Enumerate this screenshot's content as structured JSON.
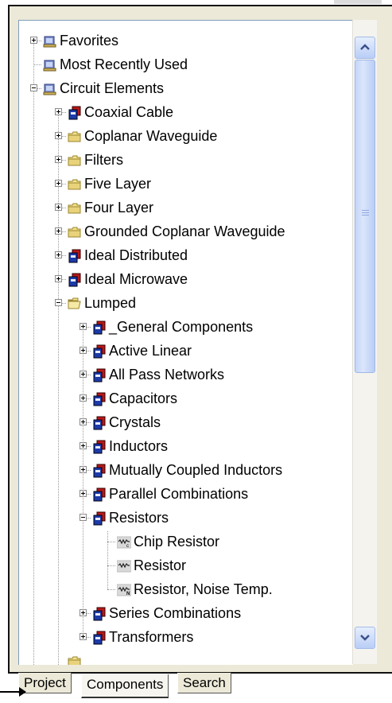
{
  "tree": {
    "nodes": [
      {
        "label": "Favorites",
        "level": 0,
        "expander": "plus",
        "icon": "library-icon"
      },
      {
        "label": "Most Recently Used",
        "level": 0,
        "expander": "none",
        "icon": "library-icon"
      },
      {
        "label": "Circuit Elements",
        "level": 0,
        "expander": "minus",
        "icon": "library-icon"
      },
      {
        "label": "Coaxial Cable",
        "level": 1,
        "expander": "plus",
        "icon": "element-group-icon"
      },
      {
        "label": "Coplanar Waveguide",
        "level": 1,
        "expander": "plus",
        "icon": "folder-icon"
      },
      {
        "label": "Filters",
        "level": 1,
        "expander": "plus",
        "icon": "folder-icon"
      },
      {
        "label": "Five Layer",
        "level": 1,
        "expander": "plus",
        "icon": "folder-icon"
      },
      {
        "label": "Four Layer",
        "level": 1,
        "expander": "plus",
        "icon": "folder-icon"
      },
      {
        "label": "Grounded Coplanar Waveguide",
        "level": 1,
        "expander": "plus",
        "icon": "folder-icon"
      },
      {
        "label": "Ideal Distributed",
        "level": 1,
        "expander": "plus",
        "icon": "element-group-icon"
      },
      {
        "label": "Ideal Microwave",
        "level": 1,
        "expander": "plus",
        "icon": "element-group-icon"
      },
      {
        "label": "Lumped",
        "level": 1,
        "expander": "minus",
        "icon": "folder-open-icon"
      },
      {
        "label": "_General Components",
        "level": 2,
        "expander": "plus",
        "icon": "element-group-icon"
      },
      {
        "label": "Active Linear",
        "level": 2,
        "expander": "plus",
        "icon": "element-group-icon"
      },
      {
        "label": "All Pass Networks",
        "level": 2,
        "expander": "plus",
        "icon": "element-group-icon"
      },
      {
        "label": "Capacitors",
        "level": 2,
        "expander": "plus",
        "icon": "element-group-icon"
      },
      {
        "label": "Crystals",
        "level": 2,
        "expander": "plus",
        "icon": "element-group-icon"
      },
      {
        "label": "Inductors",
        "level": 2,
        "expander": "plus",
        "icon": "element-group-icon"
      },
      {
        "label": "Mutually Coupled Inductors",
        "level": 2,
        "expander": "plus",
        "icon": "element-group-icon"
      },
      {
        "label": "Parallel Combinations",
        "level": 2,
        "expander": "plus",
        "icon": "element-group-icon"
      },
      {
        "label": "Resistors",
        "level": 2,
        "expander": "minus",
        "icon": "element-group-icon"
      },
      {
        "label": "Chip Resistor",
        "level": 3,
        "expander": "none",
        "icon": "chip-resistor-icon"
      },
      {
        "label": "Resistor",
        "level": 3,
        "expander": "none",
        "icon": "resistor-icon"
      },
      {
        "label": "Resistor, Noise Temp.",
        "level": 3,
        "expander": "none",
        "icon": "noise-resistor-icon"
      },
      {
        "label": "Series Combinations",
        "level": 2,
        "expander": "plus",
        "icon": "element-group-icon"
      },
      {
        "label": "Transformers",
        "level": 2,
        "expander": "plus",
        "icon": "element-group-icon"
      }
    ]
  },
  "tabs": [
    {
      "label": "Project",
      "active": false
    },
    {
      "label": "Components",
      "active": true
    },
    {
      "label": "Search",
      "active": false
    }
  ],
  "colors": {
    "selection_border": "#000000",
    "scroll_accent": "#b9cdf6",
    "element_red": "#b81818",
    "element_blue": "#1c3aa8",
    "folder_yellow": "#e8d27a"
  }
}
